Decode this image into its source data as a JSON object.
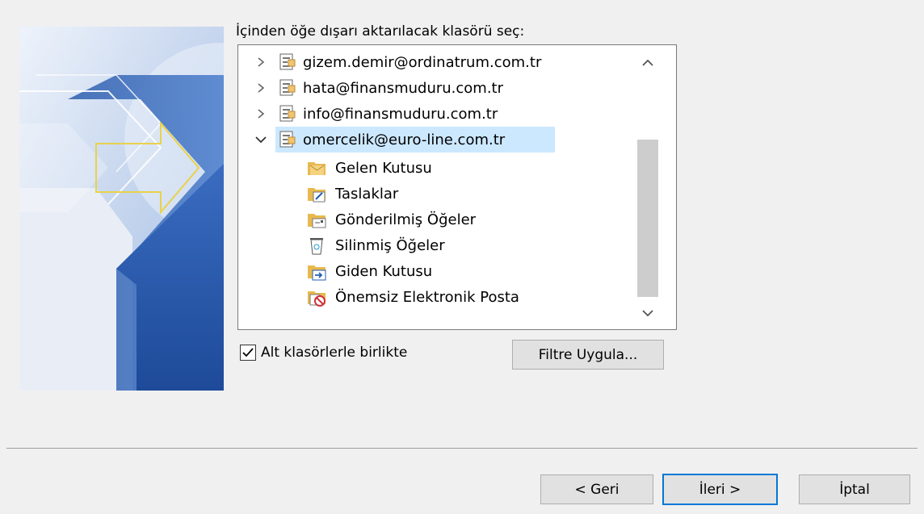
{
  "dialog": {
    "prompt": "İçinden öğe dışarı aktarılacak klasörü seç:"
  },
  "tree": {
    "accounts": [
      {
        "label": "gizem.demir@ordinatrum.com.tr",
        "expanded": false
      },
      {
        "label": "hata@finansmuduru.com.tr",
        "expanded": false
      },
      {
        "label": "info@finansmuduru.com.tr",
        "expanded": false
      },
      {
        "label": "omercelik@euro-line.com.tr",
        "expanded": true,
        "selected": true
      }
    ],
    "folders": [
      {
        "label": "Gelen Kutusu",
        "icon": "inbox-icon"
      },
      {
        "label": "Taslaklar",
        "icon": "drafts-icon"
      },
      {
        "label": "Gönderilmiş Öğeler",
        "icon": "sent-items-icon"
      },
      {
        "label": "Silinmiş Öğeler",
        "icon": "deleted-items-icon"
      },
      {
        "label": "Giden Kutusu",
        "icon": "outbox-icon"
      },
      {
        "label": "Önemsiz Elektronik Posta",
        "icon": "junk-email-icon"
      }
    ]
  },
  "options": {
    "include_subfolders_label": "Alt klasörlerle birlikte",
    "include_subfolders_checked": true,
    "filter_button": "Filtre Uygula..."
  },
  "footer": {
    "back_button": "< Geri",
    "next_button": "İleri >",
    "cancel_button": "İptal"
  },
  "colors": {
    "selection": "#cce8ff",
    "primary_border": "#0078d7"
  }
}
